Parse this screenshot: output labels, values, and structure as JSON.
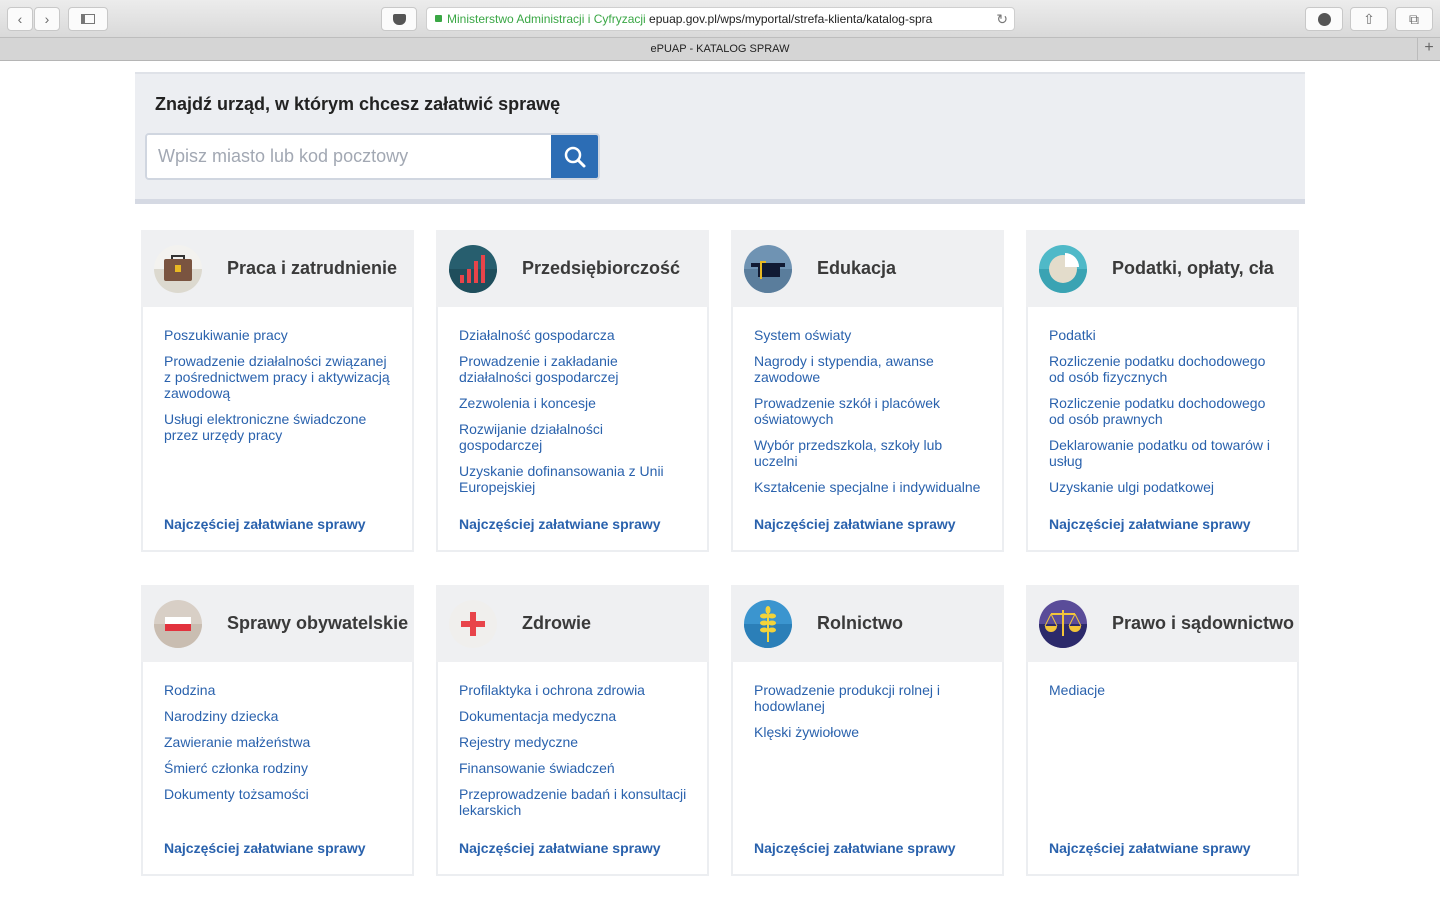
{
  "browser": {
    "url_org": "Ministerstwo Administracji i Cyfryzacji",
    "url_text": "epuap.gov.pl/wps/myportal/strefa-klienta/katalog-spra",
    "tab_title": "ePUAP - KATALOG SPRAW"
  },
  "search": {
    "heading": "Znajdź urząd, w którym chcesz załatwić sprawę",
    "placeholder": "Wpisz miasto lub kod pocztowy",
    "value": ""
  },
  "footer_link": "Najczęściej załatwiane sprawy",
  "colors": {
    "link": "#2a62ad",
    "search_button": "#2c6db5"
  },
  "categories": [
    {
      "title": "Praca i zatrudnienie",
      "icon": "briefcase-icon",
      "links": [
        "Poszukiwanie pracy",
        "Prowadzenie działalności związanej z pośrednictwem pracy i aktywizacją zawodową",
        "Usługi elektroniczne świadczone przez urzędy pracy"
      ]
    },
    {
      "title": "Przedsiębiorczość",
      "icon": "bar-chart-icon",
      "links": [
        "Działalność gospodarcza",
        "Prowadzenie i zakładanie działalności gospodarczej",
        "Zezwolenia i koncesje",
        "Rozwijanie działalności gospodarczej",
        "Uzyskanie dofinansowania z Unii Europejskiej"
      ]
    },
    {
      "title": "Edukacja",
      "icon": "graduation-cap-icon",
      "links": [
        "System oświaty",
        "Nagrody i stypendia, awanse zawodowe",
        "Prowadzenie szkół i placówek oświatowych",
        "Wybór przedszkola, szkoły lub uczelni",
        "Kształcenie specjalne i indywidualne"
      ]
    },
    {
      "title": "Podatki, opłaty, cła",
      "icon": "pie-chart-icon",
      "links": [
        "Podatki",
        "Rozliczenie podatku dochodowego od osób fizycznych",
        "Rozliczenie podatku dochodowego od osób prawnych",
        "Deklarowanie podatku od towarów i usług",
        "Uzyskanie ulgi podatkowej"
      ]
    },
    {
      "title": "Sprawy obywatelskie",
      "icon": "polish-flag-icon",
      "links": [
        "Rodzina",
        "Narodziny dziecka",
        "Zawieranie małżeństwa",
        "Śmierć członka rodziny",
        "Dokumenty tożsamości"
      ]
    },
    {
      "title": "Zdrowie",
      "icon": "red-cross-icon",
      "links": [
        "Profilaktyka i ochrona zdrowia",
        "Dokumentacja medyczna",
        "Rejestry medyczne",
        "Finansowanie świadczeń",
        "Przeprowadzenie badań i konsultacji lekarskich"
      ]
    },
    {
      "title": "Rolnictwo",
      "icon": "wheat-icon",
      "links": [
        "Prowadzenie produkcji rolnej i hodowlanej",
        "Klęski żywiołowe"
      ]
    },
    {
      "title": "Prawo i sądownictwo",
      "icon": "scales-icon",
      "links": [
        "Mediacje"
      ]
    }
  ]
}
